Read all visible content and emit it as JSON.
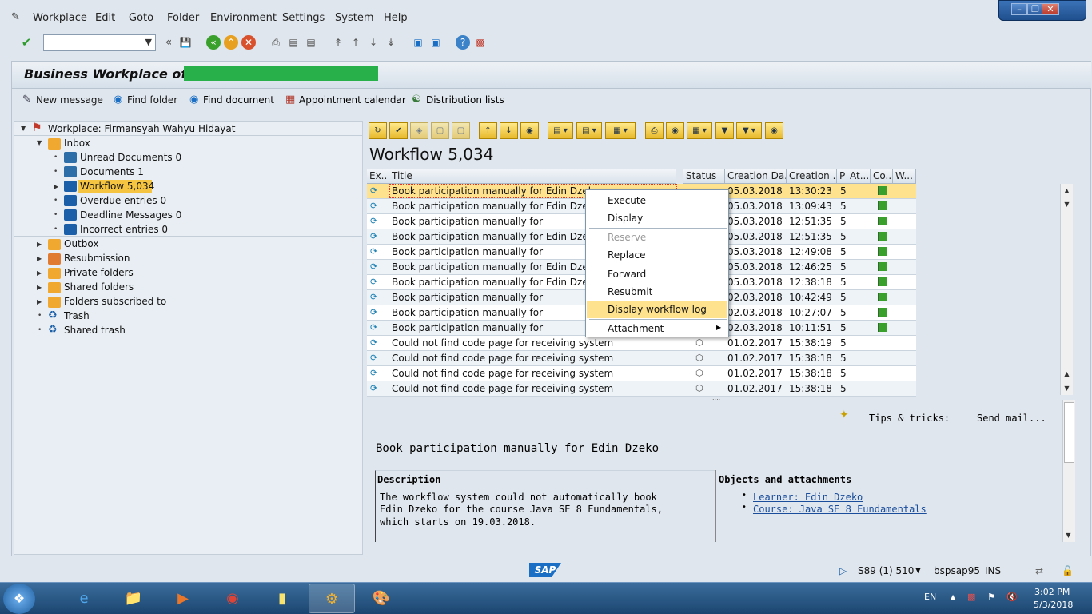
{
  "menubar": {
    "items": [
      "Workplace",
      "Edit",
      "Goto",
      "Folder",
      "Environment",
      "Settings",
      "System",
      "Help"
    ]
  },
  "toolbar": {
    "command_value": ""
  },
  "header": {
    "title": "Business Workplace of"
  },
  "app_toolbar": {
    "new_message": "New message",
    "find_folder": "Find folder",
    "find_document": "Find document",
    "appointment_calendar": "Appointment calendar",
    "distribution_lists": "Distribution lists"
  },
  "tree": {
    "root": "Workplace: Firmansyah Wahyu Hidayat",
    "inbox": "Inbox",
    "inbox_children": [
      "Unread Documents 0",
      "Documents 1",
      "Workflow 5,034",
      "Overdue entries 0",
      "Deadline Messages 0",
      "Incorrect entries 0"
    ],
    "folders": [
      "Outbox",
      "Resubmission",
      "Private folders",
      "Shared folders",
      "Folders subscribed to",
      "Trash",
      "Shared trash"
    ]
  },
  "list": {
    "title": "Workflow 5,034",
    "columns": [
      "Ex..",
      "Title",
      "Status",
      "Creation Da...",
      "Creation ...",
      "P",
      "At...",
      "Co...",
      "W..."
    ],
    "rows": [
      {
        "title": "Book participation manually for Edin Dzeko",
        "date": "05.03.2018",
        "time": "13:30:23",
        "p": "5"
      },
      {
        "title": "Book participation manually for Edin Dzeko",
        "date": "05.03.2018",
        "time": "13:09:43",
        "p": "5"
      },
      {
        "title": "Book participation manually for",
        "date": "05.03.2018",
        "time": "12:51:35",
        "p": "5"
      },
      {
        "title": "Book participation manually for Edin Dzeko",
        "date": "05.03.2018",
        "time": "12:51:35",
        "p": "5"
      },
      {
        "title": "Book participation manually for",
        "date": "05.03.2018",
        "time": "12:49:08",
        "p": "5"
      },
      {
        "title": "Book participation manually for Edin Dzeko",
        "date": "05.03.2018",
        "time": "12:46:25",
        "p": "5"
      },
      {
        "title": "Book participation manually for Edin Dzeko",
        "date": "05.03.2018",
        "time": "12:38:18",
        "p": "5"
      },
      {
        "title": "Book participation manually for",
        "date": "02.03.2018",
        "time": "10:42:49",
        "p": "5"
      },
      {
        "title": "Book participation manually for",
        "date": "02.03.2018",
        "time": "10:27:07",
        "p": "5"
      },
      {
        "title": "Book participation manually for",
        "date": "02.03.2018",
        "time": "10:11:51",
        "p": "5"
      },
      {
        "title": "Could not find code page for receiving system",
        "date": "01.02.2017",
        "time": "15:38:19",
        "p": "5"
      },
      {
        "title": "Could not find code page for receiving system",
        "date": "01.02.2017",
        "time": "15:38:18",
        "p": "5"
      },
      {
        "title": "Could not find code page for receiving system",
        "date": "01.02.2017",
        "time": "15:38:18",
        "p": "5"
      },
      {
        "title": "Could not find code page for receiving system",
        "date": "01.02.2017",
        "time": "15:38:18",
        "p": "5"
      }
    ]
  },
  "context_menu": {
    "items": [
      "Execute",
      "Display",
      "Reserve",
      "Replace",
      "Forward",
      "Resubmit",
      "Display workflow log",
      "Attachment"
    ]
  },
  "preview": {
    "tips_label": "Tips & tricks:",
    "tips_link": "Send mail...",
    "title": "Book participation manually for Edin Dzeko",
    "description_header": "Description",
    "description_lines": [
      "The workflow system could not automatically book",
      "Edin Dzeko for the course Java SE 8 Fundamentals,",
      "which starts on 19.03.2018."
    ],
    "objects_header": "Objects and attachments",
    "objects": [
      "Learner: Edin Dzeko",
      "Course: Java SE 8 Fundamentals"
    ]
  },
  "statusbar": {
    "logo": "SAP",
    "system": "S89 (1) 510",
    "server": "bspsap95",
    "mode": "INS"
  },
  "taskbar": {
    "lang": "EN",
    "time": "3:02 PM",
    "date": "5/3/2018"
  },
  "colors": {
    "selected_row": "#fee28d",
    "accent_green": "#28b14a",
    "taskbar": "#1b4570"
  }
}
